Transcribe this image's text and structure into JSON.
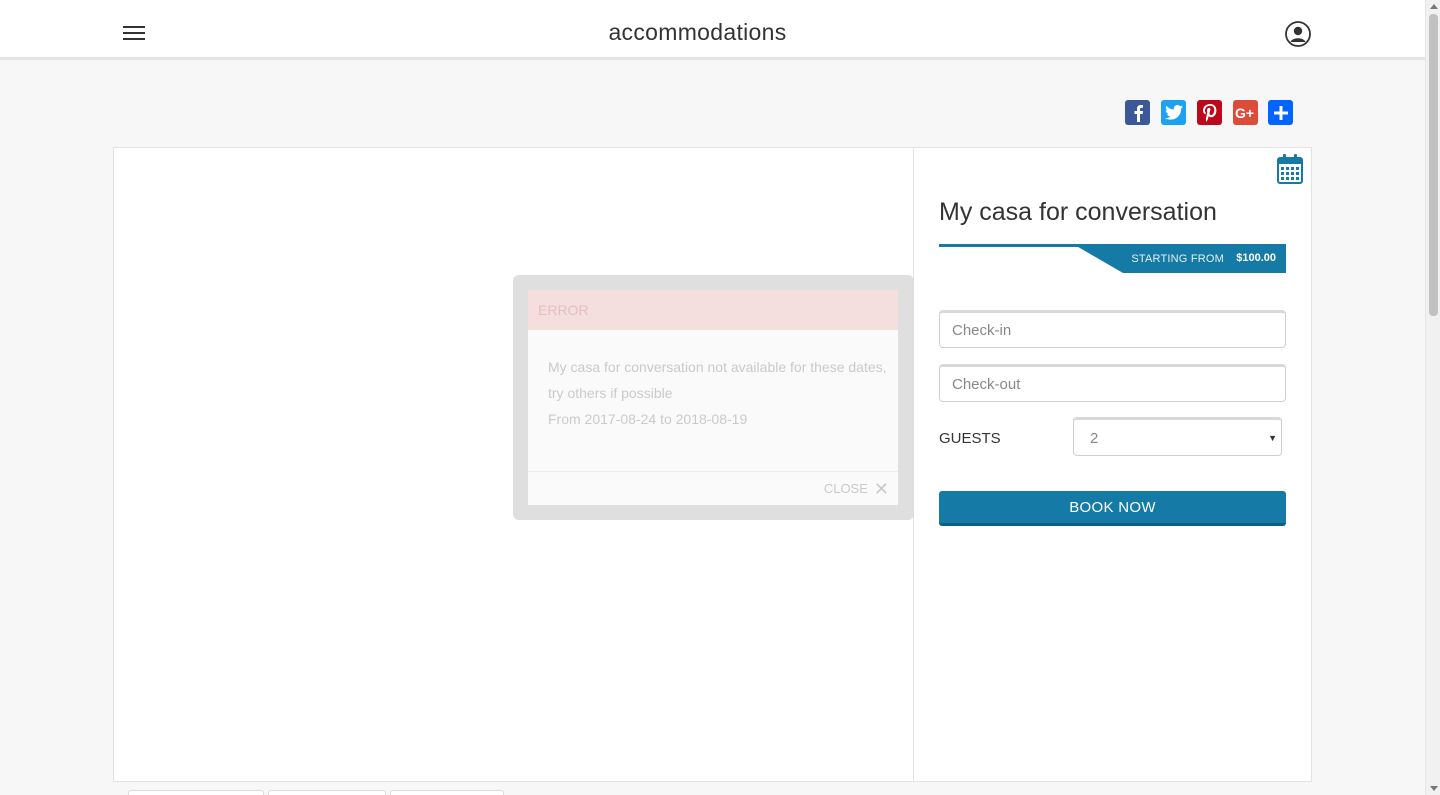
{
  "header": {
    "title": "accommodations"
  },
  "share": {
    "items": [
      {
        "name": "facebook",
        "color": "#3b5998"
      },
      {
        "name": "twitter",
        "color": "#1da1f2"
      },
      {
        "name": "pinterest",
        "color": "#bd081c"
      },
      {
        "name": "google-plus",
        "color": "#dd4b39"
      },
      {
        "name": "share",
        "color": "#0166ff"
      }
    ]
  },
  "listing": {
    "title": "My casa for conversation",
    "price_label": "STARTING FROM",
    "price": "$100.00"
  },
  "booking": {
    "checkin_placeholder": "Check-in",
    "checkout_placeholder": "Check-out",
    "guests_label": "GUESTS",
    "guests_value": "2",
    "book_label": "BOOK NOW"
  },
  "modal": {
    "title": "ERROR",
    "message": "My casa for conversation not available for these dates, try others if possible",
    "dates": "From 2017-08-24 to 2018-08-19",
    "close_label": "CLOSE"
  },
  "colors": {
    "accent": "#157aa6",
    "error_bg": "#f9dede"
  }
}
